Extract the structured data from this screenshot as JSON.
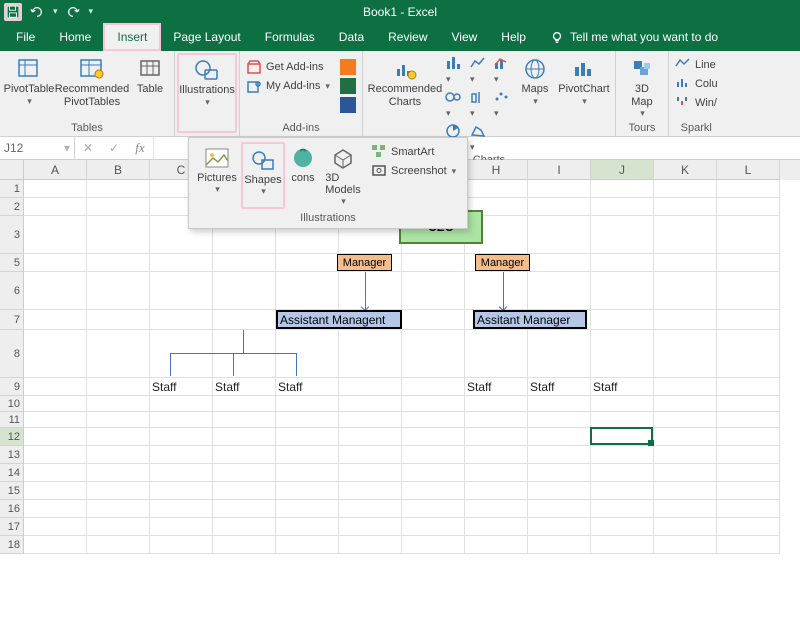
{
  "title": "Book1 - Excel",
  "menu": [
    "File",
    "Home",
    "Insert",
    "Page Layout",
    "Formulas",
    "Data",
    "Review",
    "View",
    "Help"
  ],
  "menu_active": "Insert",
  "tellme": "Tell me what you want to do",
  "ribbon": {
    "tables": {
      "pivottable": "PivotTable",
      "recommended_pt": "Recommended\nPivotTables",
      "table": "Table",
      "label": "Tables"
    },
    "illustrations": {
      "btn": "Illustrations"
    },
    "addins": {
      "get": "Get Add-ins",
      "my": "My Add-ins",
      "label": "Add-ins"
    },
    "charts": {
      "rec": "Recommended\nCharts",
      "maps": "Maps",
      "pivotchart": "PivotChart",
      "label": "Charts"
    },
    "tours": {
      "map3d": "3D\nMap",
      "label": "Tours"
    },
    "spark": {
      "line": "Line",
      "column": "Colu",
      "winloss": "Win/",
      "label": "Sparkl"
    }
  },
  "illus_dd": {
    "pictures": "Pictures",
    "shapes": "Shapes",
    "icons": "cons",
    "models": "3D\nModels",
    "smartart": "SmartArt",
    "screenshot": "Screenshot",
    "label": "Illustrations"
  },
  "name_box": "J12",
  "columns": [
    "A",
    "B",
    "C",
    "D",
    "E",
    "F",
    "G",
    "H",
    "I",
    "J",
    "K",
    "L"
  ],
  "rows": [
    "1",
    "2",
    "3",
    "5",
    "6",
    "7",
    "8",
    "9",
    "10",
    "11",
    "12",
    "13",
    "14",
    "15",
    "16",
    "17",
    "18"
  ],
  "row_heights": {
    "1": 18,
    "2": 18,
    "3": 38,
    "5": 18,
    "6": 38,
    "7": 20,
    "8": 48,
    "9": 18,
    "10": 16,
    "11": 16,
    "12": 18,
    "13": 18,
    "14": 18,
    "15": 18,
    "16": 18,
    "17": 18,
    "18": 18
  },
  "org": {
    "ceo": "CEO",
    "mgr1": "Manager",
    "mgr2": "Manager",
    "am1": "Assistant Managent",
    "am2": "Assitant Manager",
    "staff": "Staff"
  },
  "staff_cells": {
    "c9": "Staff",
    "d9": "Staff",
    "e9": "Staff",
    "h9": "Staff",
    "i9": "Staff",
    "j9": "Staff"
  }
}
